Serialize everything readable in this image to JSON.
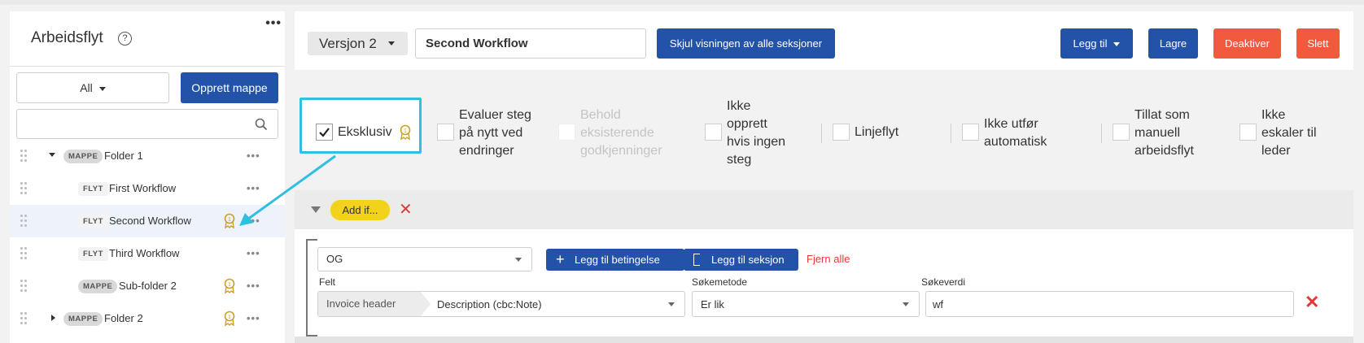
{
  "sidebar": {
    "title": "Arbeidsflyt",
    "help_icon": "question-circle-icon",
    "more_icon": "•••",
    "filter_value": "All",
    "create_folder_label": "Opprett mappe",
    "search_placeholder": "",
    "row_more": "•••",
    "tree": [
      {
        "badge": "MAPPE",
        "label": "Folder 1",
        "award": false,
        "expanded": true
      },
      {
        "badge": "FLYT",
        "label": "First Workflow",
        "award": false
      },
      {
        "badge": "FLYT",
        "label": "Second Workflow",
        "award": true,
        "selected": true
      },
      {
        "badge": "FLYT",
        "label": "Third Workflow",
        "award": false
      },
      {
        "badge": "MAPPE",
        "label": "Sub-folder 2",
        "award": true
      },
      {
        "badge": "MAPPE",
        "label": "Folder 2",
        "award": true,
        "expanded": false
      }
    ]
  },
  "toolbar": {
    "version_label": "Versjon 2",
    "workflow_name": "Second Workflow",
    "hide_sections_label": "Skjul visningen av alle seksjoner",
    "add_label": "Legg til",
    "save_label": "Lagre",
    "deactivate_label": "Deaktiver",
    "delete_label": "Slett"
  },
  "options": [
    {
      "label_lines": [
        "Eksklusiv"
      ],
      "checked": true,
      "disabled": false,
      "award": true
    },
    {
      "label_lines": [
        "Evaluer steg",
        "på nytt ved",
        "endringer"
      ],
      "checked": false,
      "disabled": false
    },
    {
      "label_lines": [
        "Behold",
        "eksisterende",
        "godkjenninger"
      ],
      "checked": false,
      "disabled": true
    },
    {
      "label_lines": [
        "Ikke",
        "opprett",
        "hvis ingen",
        "steg"
      ],
      "checked": false,
      "disabled": false
    },
    {
      "label_lines": [
        "Linjeflyt"
      ],
      "checked": false,
      "disabled": false
    },
    {
      "label_lines": [
        "Ikke utfør",
        "automatisk"
      ],
      "checked": false,
      "disabled": false
    },
    {
      "label_lines": [
        "Tillat som",
        "manuell",
        "arbeidsflyt"
      ],
      "checked": false,
      "disabled": false
    },
    {
      "label_lines": [
        "Ikke",
        "eskaler til",
        "leder"
      ],
      "checked": false,
      "disabled": false
    }
  ],
  "section": {
    "add_if_label": "Add if...",
    "remove_icon": "✕",
    "operator_value": "OG",
    "add_condition_label": "Legg til betingelse",
    "add_section_label": "Legg til seksjon",
    "remove_all_label": "Fjern alle",
    "field_header": "Felt",
    "method_header": "Søkemetode",
    "value_header": "Søkeverdi",
    "field_prefix": "Invoice header",
    "field_value": "Description (cbc:Note)",
    "method_value": "Er lik",
    "search_value": "wf",
    "row_remove_icon": "✕"
  },
  "colors": {
    "primary": "#2353a8",
    "danger": "#f15a3c",
    "highlight": "#2fbfe0",
    "add_if": "#f3d21c",
    "award": "#c9a227"
  }
}
